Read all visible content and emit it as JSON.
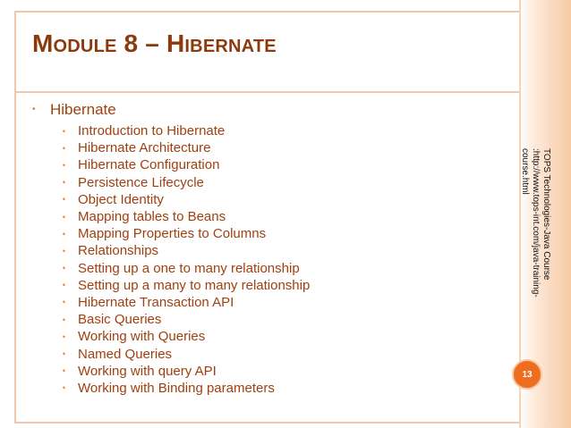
{
  "slide": {
    "title": "Module 8 – Hibernate",
    "main_item": "Hibernate",
    "subitems": [
      "Introduction to Hibernate",
      "Hibernate Architecture",
      "Hibernate Configuration",
      "Persistence Lifecycle",
      "Object Identity",
      "Mapping tables to Beans",
      "Mapping Properties to Columns",
      "Relationships",
      "Setting up a one to many relationship",
      "Setting up a many to many relationship",
      "Hibernate Transaction API",
      "Basic Queries",
      "Working with Queries",
      "Named Queries",
      "Working with query API",
      "Working with Binding parameters"
    ],
    "side_text": "TOPS Technologies-Java Course :http://www.tops-int.com/java-training-course.html",
    "page_number": "13"
  },
  "colors": {
    "title": "#8b3a0d",
    "text": "#a04010",
    "bullet": "#e07b39",
    "frame": "#f0c9ac",
    "badge": "#ee6e1f"
  }
}
